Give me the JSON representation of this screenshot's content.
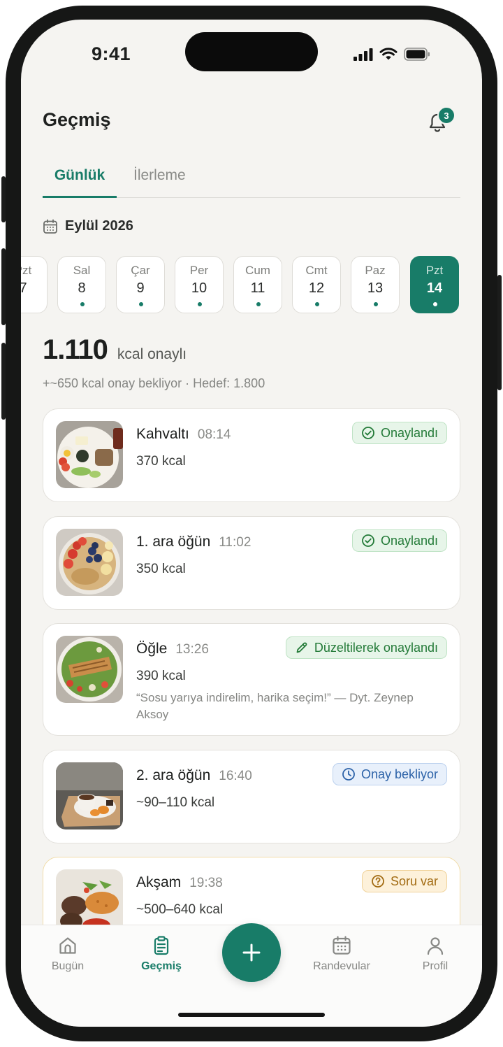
{
  "status_bar": {
    "time": "9:41"
  },
  "header": {
    "title": "Geçmiş",
    "notification_count": "3"
  },
  "tabs": [
    {
      "label": "Günlük",
      "active": true
    },
    {
      "label": "İlerleme",
      "active": false
    }
  ],
  "calendar": {
    "month_label": "Eylül 2026",
    "days": [
      {
        "name": "Pzt",
        "date": "7"
      },
      {
        "name": "Sal",
        "date": "8"
      },
      {
        "name": "Çar",
        "date": "9"
      },
      {
        "name": "Per",
        "date": "10"
      },
      {
        "name": "Cum",
        "date": "11"
      },
      {
        "name": "Cmt",
        "date": "12"
      },
      {
        "name": "Paz",
        "date": "13"
      },
      {
        "name": "Pzt",
        "date": "14",
        "selected": true
      }
    ]
  },
  "summary": {
    "approved_kcal": "1.110",
    "approved_unit": "kcal onaylı",
    "pending_line": "+~650 kcal onay bekliyor · Hedef: 1.800"
  },
  "meals": [
    {
      "name": "Kahvaltı",
      "time": "08:14",
      "kcal": "370 kcal",
      "status": "Onaylandı",
      "status_type": "approved"
    },
    {
      "name": "1. ara öğün",
      "time": "11:02",
      "kcal": "350 kcal",
      "status": "Onaylandı",
      "status_type": "approved"
    },
    {
      "name": "Öğle",
      "time": "13:26",
      "kcal": "390 kcal",
      "status": "Düzeltilerek onaylandı",
      "status_type": "edited",
      "note": "“Sosu yarıya indirelim, harika seçim!” — Dyt. Zeynep Aksoy"
    },
    {
      "name": "2. ara öğün",
      "time": "16:40",
      "kcal": "~90–110 kcal",
      "status": "Onay bekliyor",
      "status_type": "pending"
    },
    {
      "name": "Akşam",
      "time": "19:38",
      "kcal": "~500–640 kcal",
      "status": "Soru var",
      "status_type": "question"
    }
  ],
  "bottom_nav": {
    "items": [
      {
        "label": "Bugün",
        "icon": "home-icon"
      },
      {
        "label": "Geçmiş",
        "icon": "clipboard-icon",
        "active": true
      },
      {
        "label": "Randevular",
        "icon": "calendar-icon"
      },
      {
        "label": "Profil",
        "icon": "user-icon"
      }
    ],
    "fab_icon": "plus-icon"
  },
  "colors": {
    "accent": "#187c68",
    "approved": "#237a38",
    "pending": "#2c62a8",
    "question": "#a26b12",
    "background": "#f5f4f1"
  }
}
